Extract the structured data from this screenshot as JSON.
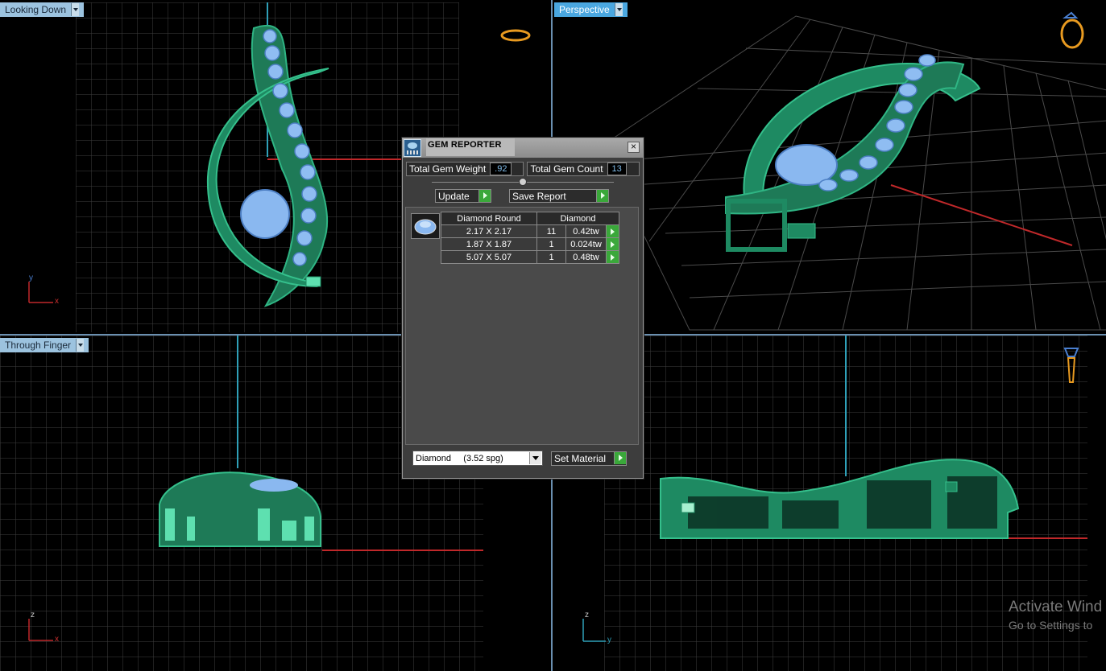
{
  "viewports": {
    "top_left": {
      "label": "Looking Down",
      "axis1": "y",
      "axis2": "x"
    },
    "top_right": {
      "label": "Perspective"
    },
    "bottom_left": {
      "label": "Through Finger",
      "axis1": "z",
      "axis2": "x"
    },
    "bottom_right": {
      "label": "",
      "axis1": "z",
      "axis2": "y"
    }
  },
  "dialog": {
    "title": "GEM REPORTER",
    "close": "×",
    "total_weight_label": "Total Gem Weight",
    "total_weight_value": ".92",
    "total_count_label": "Total Gem Count",
    "total_count_value": "13",
    "update_label": "Update",
    "save_label": "Save Report",
    "table": {
      "header_shape": "Diamond Round",
      "header_material": "Diamond",
      "rows": [
        {
          "size": "2.17 X 2.17",
          "count": "11",
          "weight": "0.42tw"
        },
        {
          "size": "1.87 X 1.87",
          "count": "1",
          "weight": "0.024tw"
        },
        {
          "size": "5.07 X 5.07",
          "count": "1",
          "weight": "0.48tw"
        }
      ]
    },
    "material_select": "Diamond     (3.52 spg)",
    "set_material_label": "Set Material"
  },
  "watermark": {
    "line1": "Activate Wind",
    "line2": "Go to Settings to"
  },
  "colors": {
    "grid": "#3f3f3f",
    "model": "#1e8a62",
    "gem": "#8ab8f0",
    "accent": "#4aa7e0",
    "axis_red": "#c0282a",
    "axis_cyan": "#2fa0b8"
  }
}
